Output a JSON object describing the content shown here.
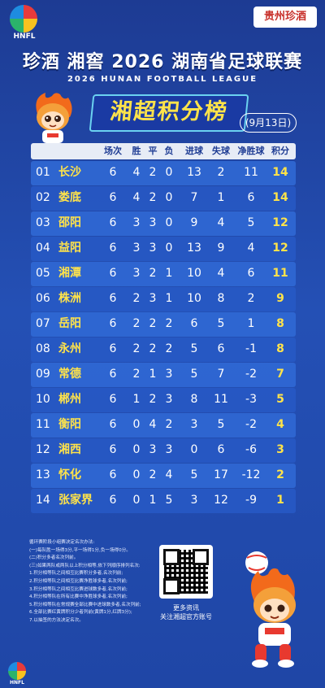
{
  "header": {
    "logo_text": "HNFL",
    "sponsor": "贵州珍酒",
    "title": "珍酒 湘窖 2026 湖南省足球联赛",
    "subtitle": "2026 HUNAN FOOTBALL LEAGUE",
    "board_title": "湘超积分榜",
    "date": "(9月13日)"
  },
  "table": {
    "columns": [
      "场次",
      "胜",
      "平",
      "负",
      "进球",
      "失球",
      "净胜球",
      "积分"
    ],
    "rows": [
      {
        "rank": "01",
        "team": "长沙",
        "p": "6",
        "w": "4",
        "d": "2",
        "l": "0",
        "gf": "13",
        "ga": "2",
        "gd": "11",
        "pts": "14"
      },
      {
        "rank": "02",
        "team": "娄底",
        "p": "6",
        "w": "4",
        "d": "2",
        "l": "0",
        "gf": "7",
        "ga": "1",
        "gd": "6",
        "pts": "14"
      },
      {
        "rank": "03",
        "team": "邵阳",
        "p": "6",
        "w": "3",
        "d": "3",
        "l": "0",
        "gf": "9",
        "ga": "4",
        "gd": "5",
        "pts": "12"
      },
      {
        "rank": "04",
        "team": "益阳",
        "p": "6",
        "w": "3",
        "d": "3",
        "l": "0",
        "gf": "13",
        "ga": "9",
        "gd": "4",
        "pts": "12"
      },
      {
        "rank": "05",
        "team": "湘潭",
        "p": "6",
        "w": "3",
        "d": "2",
        "l": "1",
        "gf": "10",
        "ga": "4",
        "gd": "6",
        "pts": "11"
      },
      {
        "rank": "06",
        "team": "株洲",
        "p": "6",
        "w": "2",
        "d": "3",
        "l": "1",
        "gf": "10",
        "ga": "8",
        "gd": "2",
        "pts": "9"
      },
      {
        "rank": "07",
        "team": "岳阳",
        "p": "6",
        "w": "2",
        "d": "2",
        "l": "2",
        "gf": "6",
        "ga": "5",
        "gd": "1",
        "pts": "8"
      },
      {
        "rank": "08",
        "team": "永州",
        "p": "6",
        "w": "2",
        "d": "2",
        "l": "2",
        "gf": "5",
        "ga": "6",
        "gd": "-1",
        "pts": "8"
      },
      {
        "rank": "09",
        "team": "常德",
        "p": "6",
        "w": "2",
        "d": "1",
        "l": "3",
        "gf": "5",
        "ga": "7",
        "gd": "-2",
        "pts": "7"
      },
      {
        "rank": "10",
        "team": "郴州",
        "p": "6",
        "w": "1",
        "d": "2",
        "l": "3",
        "gf": "8",
        "ga": "11",
        "gd": "-3",
        "pts": "5"
      },
      {
        "rank": "11",
        "team": "衡阳",
        "p": "6",
        "w": "0",
        "d": "4",
        "l": "2",
        "gf": "3",
        "ga": "5",
        "gd": "-2",
        "pts": "4"
      },
      {
        "rank": "12",
        "team": "湘西",
        "p": "6",
        "w": "0",
        "d": "3",
        "l": "3",
        "gf": "0",
        "ga": "6",
        "gd": "-6",
        "pts": "3"
      },
      {
        "rank": "13",
        "team": "怀化",
        "p": "6",
        "w": "0",
        "d": "2",
        "l": "4",
        "gf": "5",
        "ga": "17",
        "gd": "-12",
        "pts": "2"
      },
      {
        "rank": "14",
        "team": "张家界",
        "p": "6",
        "w": "0",
        "d": "1",
        "l": "5",
        "gf": "3",
        "ga": "12",
        "gd": "-9",
        "pts": "1"
      }
    ]
  },
  "rules": {
    "lines": [
      "循环赛阶段小组赛决定名次办法:",
      "(一)每队胜一场得3分,平一场得1分,负一场得0分。",
      "(二)积分多者名次列前。",
      "(三)如果两队或两队以上积分相等,依下列顺序排列名次:",
      "1.积分相等队之间相互比赛积分多者,名次列前;",
      "2.积分相等队之间相互比赛净胜球多者,名次列前;",
      "3.积分相等队之间相互比赛进球数多者,名次列前;",
      "4.积分相等队在所有比赛中净胜球多者,名次列前;",
      "5.积分相等队在常规赛全部比赛中进球数多者,名次列前;",
      "6.全部比赛红黄牌积分少者列前(黄牌1分,红牌3分);",
      "7.以抽签的方法决定名次。"
    ]
  },
  "qr": {
    "line1": "更多资讯",
    "line2": "关注湘超官方账号"
  },
  "footer": {
    "logo_text": "HNFL"
  }
}
